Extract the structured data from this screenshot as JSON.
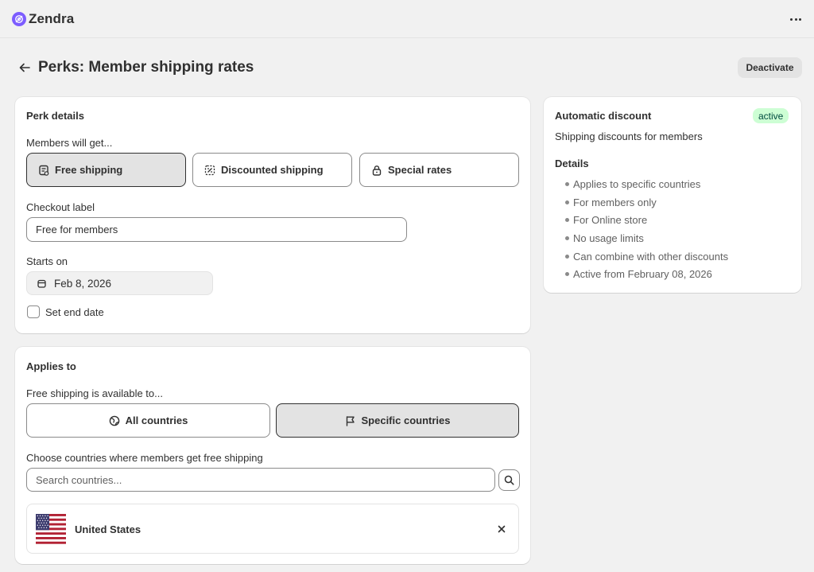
{
  "app": {
    "name": "Zendra"
  },
  "header": {
    "title": "Perks: Member shipping rates",
    "deactivate_label": "Deactivate"
  },
  "perk_details": {
    "title": "Perk details",
    "members_label": "Members will get...",
    "options": [
      {
        "label": "Free shipping",
        "selected": true,
        "icon": "receipt-icon"
      },
      {
        "label": "Discounted shipping",
        "selected": false,
        "icon": "discount-icon"
      },
      {
        "label": "Special rates",
        "selected": false,
        "icon": "lock-icon"
      }
    ],
    "checkout_label": "Checkout label",
    "checkout_value": "Free for members",
    "starts_on_label": "Starts on",
    "starts_on_value": "Feb 8, 2026",
    "end_date_label": "Set end date",
    "end_date_checked": false
  },
  "applies_to": {
    "title": "Applies to",
    "available_label": "Free shipping is available to...",
    "options": [
      {
        "label": "All countries",
        "selected": false,
        "icon": "globe-icon"
      },
      {
        "label": "Specific countries",
        "selected": true,
        "icon": "flag-icon"
      }
    ],
    "choose_label": "Choose countries where members get free shipping",
    "search_placeholder": "Search countries...",
    "countries": [
      {
        "name": "United States",
        "flag": "us-flag-icon"
      }
    ]
  },
  "summary": {
    "title": "Automatic discount",
    "status": "active",
    "subtitle": "Shipping discounts for members",
    "details_title": "Details",
    "details": [
      "Applies to specific countries",
      "For members only",
      "For Online store",
      "No usage limits",
      "Can combine with other discounts",
      "Active from February 08, 2026"
    ]
  },
  "colors": {
    "brand": "#7c5cff",
    "selected_bg": "#e3e3e3",
    "active_badge_bg": "#cdfed4",
    "active_badge_text": "#014b40"
  }
}
